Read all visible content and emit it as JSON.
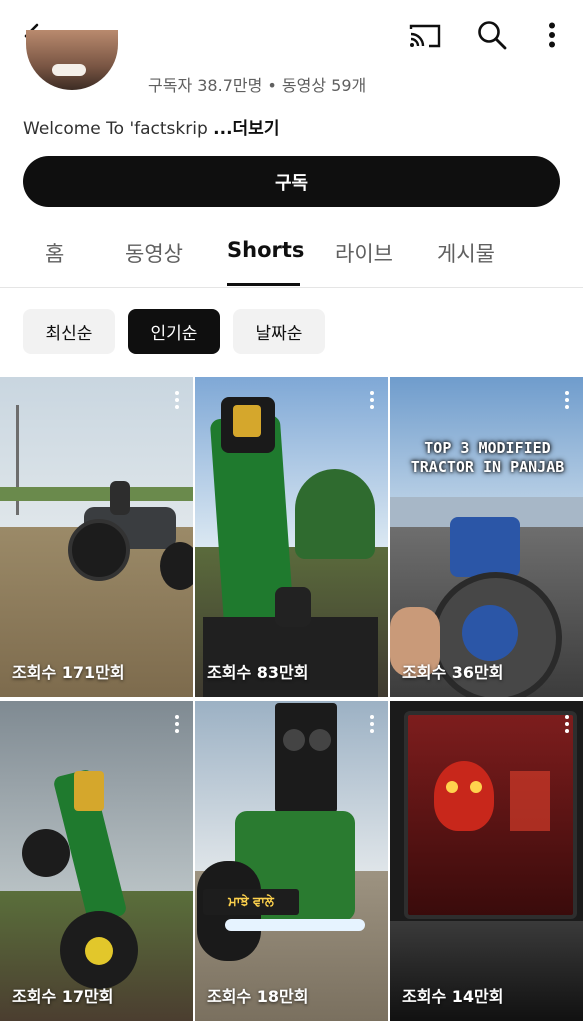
{
  "header": {
    "icons": [
      "back-arrow-icon",
      "cast-icon",
      "search-icon",
      "more-vert-icon"
    ]
  },
  "channel": {
    "stats": "구독자 38.7만명 • 동영상 59개",
    "description": "Welcome To 'factskrip ",
    "more_label": "...더보기",
    "subscribe_label": "구독"
  },
  "tabs": [
    {
      "label": "홈",
      "active": false
    },
    {
      "label": "동영상",
      "active": false
    },
    {
      "label": "Shorts",
      "active": true
    },
    {
      "label": "라이브",
      "active": false
    },
    {
      "label": "게시물",
      "active": false
    }
  ],
  "chips": [
    {
      "label": "최신순",
      "active": false
    },
    {
      "label": "인기순",
      "active": true
    },
    {
      "label": "날짜순",
      "active": false
    }
  ],
  "shorts": [
    {
      "views": "조회수 171만회"
    },
    {
      "views": "조회수 83만회"
    },
    {
      "views": "조회수 36만회",
      "overlay_text": "TOP 3 MODIFIED TRACTOR IN PANJAB"
    },
    {
      "views": "조회수 17만회"
    },
    {
      "views": "조회수 18만회",
      "plate_text": "ਮਾਝੇ ਵਾਲੇ"
    },
    {
      "views": "조회수 14만회"
    }
  ]
}
